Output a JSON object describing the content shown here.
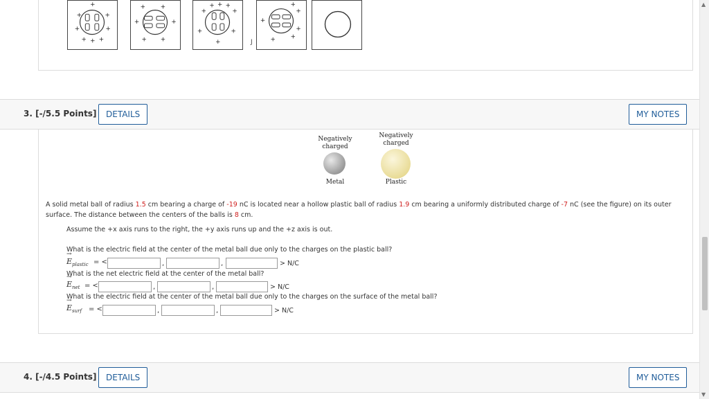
{
  "previous_question": {
    "figures": [
      {
        "icon": "charged-grid-figure-1"
      },
      {
        "icon": "charged-grid-figure-2"
      },
      {
        "icon": "charged-grid-figure-3"
      },
      {
        "icon": "charged-grid-figure-4"
      },
      {
        "icon": "empty-circle-figure"
      }
    ],
    "small_mark": "J"
  },
  "question3": {
    "title": "3.  [-/5.5 Points]",
    "details_label": "DETAILS",
    "notes_label": "MY NOTES",
    "figure": {
      "metal_top_label_1": "Negatively",
      "metal_top_label_2": "charged",
      "plastic_top_label_1": "Negatively",
      "plastic_top_label_2": "charged",
      "metal_label": "Metal",
      "plastic_label": "Plastic",
      "metal_color": "#b5b5b5",
      "plastic_color": "#efe3a6"
    },
    "problem": {
      "p1": "A solid metal ball of radius ",
      "r1": "1.5",
      "p2": " cm bearing a charge of ",
      "q1": "-19",
      "p3": " nC is located near a hollow plastic ball of radius ",
      "r2": "1.9",
      "p4": " cm bearing a uniformly distributed charge of ",
      "q2": "-7",
      "p5": " nC (see the figure) on its outer surface. The distance between the centers of the balls is ",
      "d": "8",
      "p6": " cm."
    },
    "assume": "Assume the +x axis runs to the right, the +y axis runs up and the +z axis is out.",
    "q_a": "What is the electric field at the center of the metal ball due only to the charges on the plastic ball?",
    "q_b": "What is the net electric field at the center of the metal ball?",
    "q_c": "What is the electric field at the center of the metal ball due only to the charges on the surface of the metal ball?",
    "e_a": "E",
    "e_a_sub": "plastic",
    "e_b": "E",
    "e_b_sub": "net",
    "e_c": "E",
    "e_c_sub": "surf",
    "eq_open": "= <",
    "comma": ",",
    "close_unit": "> N/C",
    "answers": {
      "a": [
        "",
        "",
        ""
      ],
      "b": [
        "",
        "",
        ""
      ],
      "c": [
        "",
        "",
        ""
      ]
    }
  },
  "question4": {
    "title": "4.  [-/4.5 Points]",
    "details_label": "DETAILS",
    "notes_label": "MY NOTES"
  }
}
